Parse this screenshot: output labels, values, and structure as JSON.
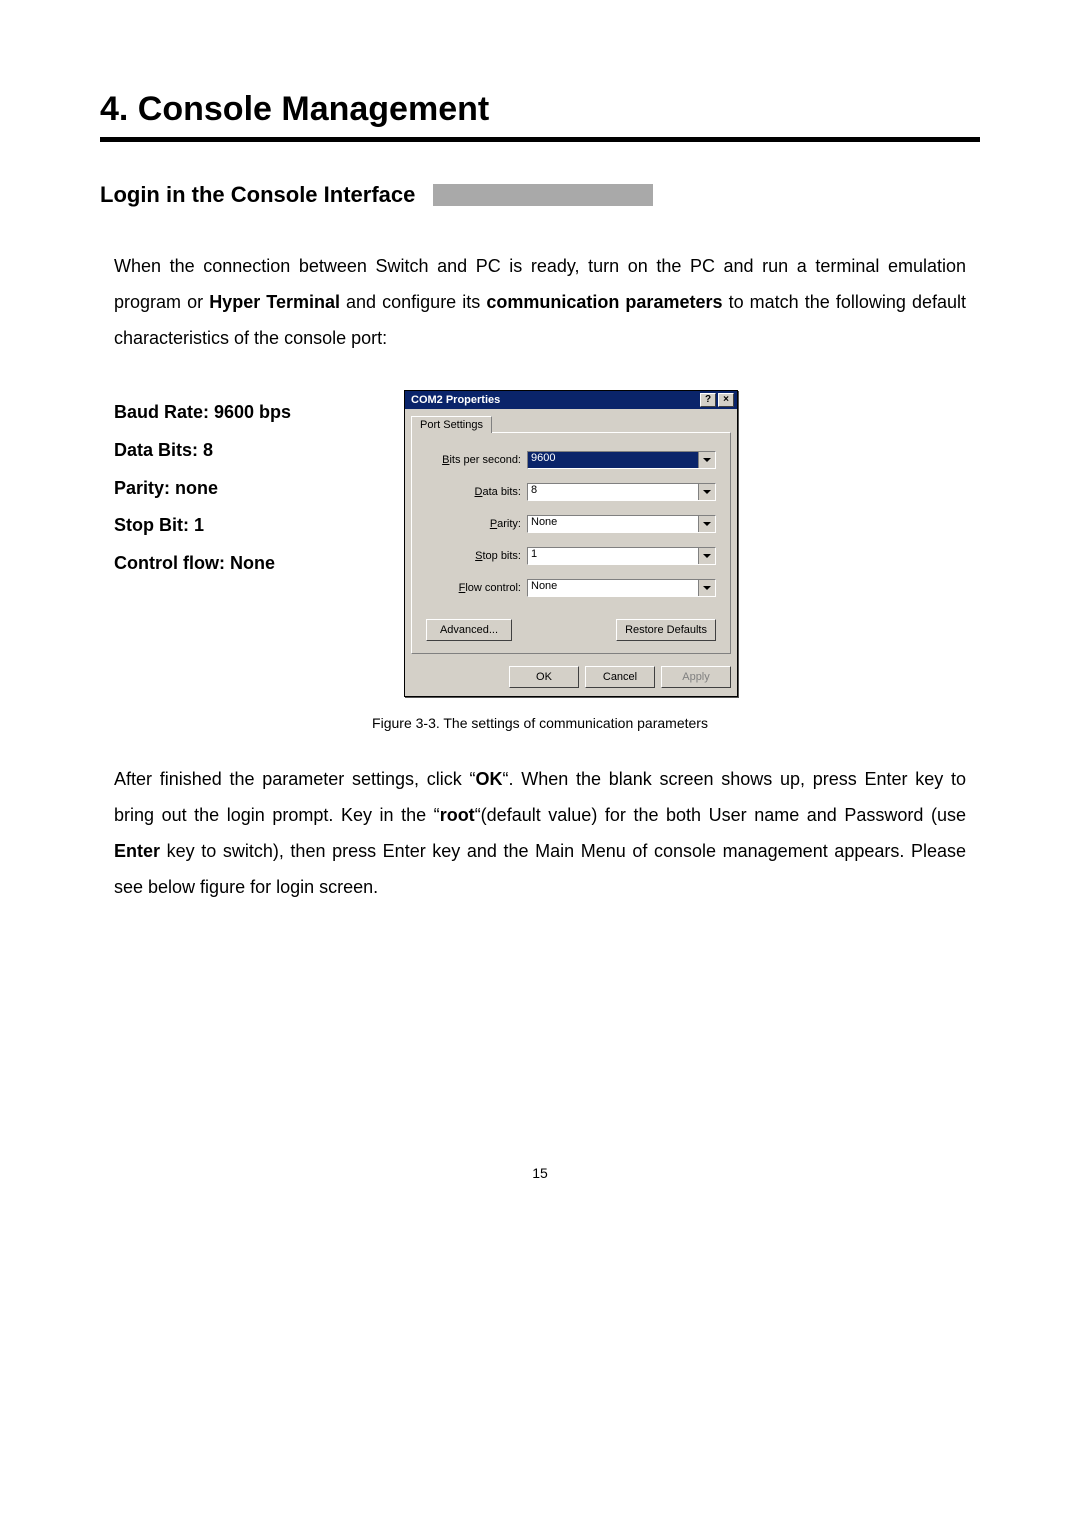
{
  "chapter_title": "4. Console Management",
  "section_title": "Login in the Console Interface",
  "intro_parts": {
    "p1": "When the connection between Switch and PC is ready, turn on the PC and run a terminal emulation program or ",
    "b1": "Hyper Terminal",
    "p2": " and configure its ",
    "b2": "communication parameters",
    "p3": " to match the following default characteristics of the console port:"
  },
  "params": {
    "baud": "Baud Rate: 9600 bps",
    "data_bits": "Data Bits: 8",
    "parity": "Parity: none",
    "stop_bit": "Stop Bit: 1",
    "flow": "Control flow: None"
  },
  "dialog": {
    "title": "COM2 Properties",
    "help_btn": "?",
    "close_btn": "×",
    "tab": "Port Settings",
    "fields": {
      "bps": {
        "label_pre": "B",
        "label_rest": "its per second:",
        "value": "9600"
      },
      "data": {
        "label_pre": "D",
        "label_rest": "ata bits:",
        "value": "8"
      },
      "parity": {
        "label_pre": "P",
        "label_rest": "arity:",
        "value": "None"
      },
      "stop": {
        "label_pre": "S",
        "label_rest": "top bits:",
        "value": "1"
      },
      "flow": {
        "label_pre": "F",
        "label_rest": "low control:",
        "value": "None"
      }
    },
    "buttons": {
      "advanced": "Advanced...",
      "restore": "Restore Defaults",
      "ok": "OK",
      "cancel": "Cancel",
      "apply": "Apply"
    }
  },
  "figure_caption": "Figure 3-3. The settings of communication parameters",
  "after_parts": {
    "p1": "After finished the parameter settings, click “",
    "b1": "OK",
    "p2": "“. When the blank screen shows up, press Enter key to bring out the login prompt. Key in the “",
    "b2": "root",
    "p3": "“(default value) for the both User name and Password (use ",
    "b3": "Enter",
    "p4": " key to switch), then press Enter key and the Main Menu of console management appears. Please see below figure for login screen."
  },
  "page_number": "15"
}
